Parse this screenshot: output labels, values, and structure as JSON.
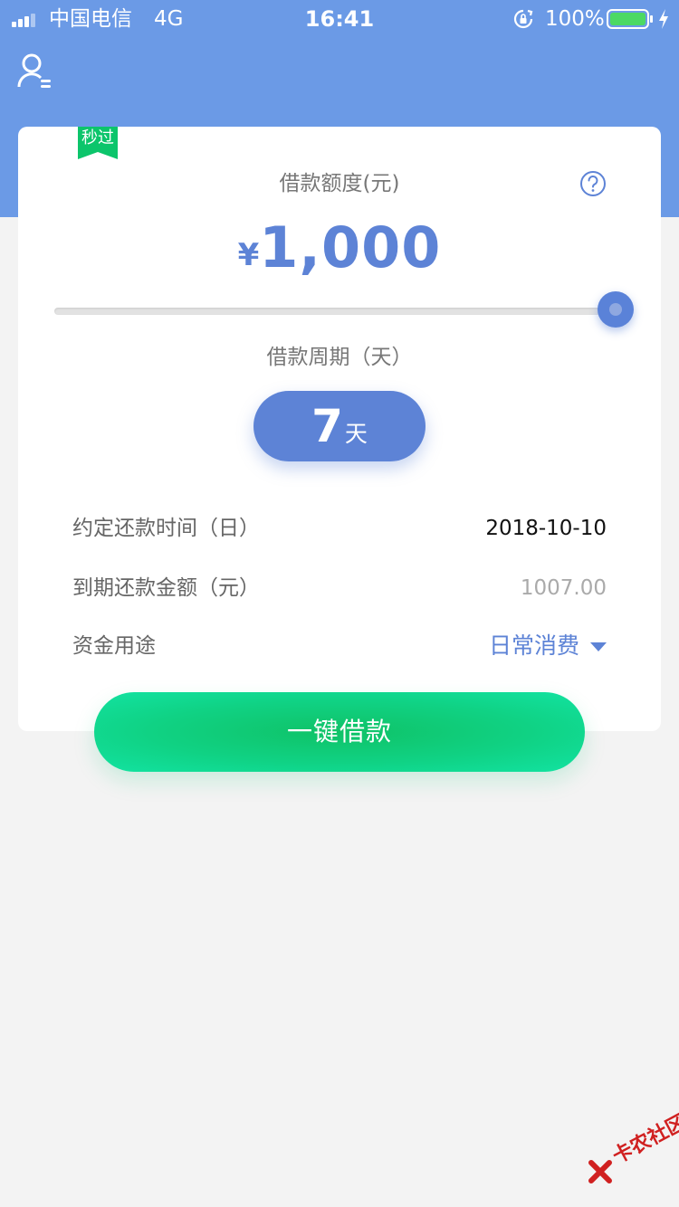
{
  "status_bar": {
    "carrier": "中国电信",
    "network": "4G",
    "time": "16:41",
    "battery_percent": "100%"
  },
  "header": {
    "profile_icon": "user-list-icon"
  },
  "card": {
    "badge": "秒过",
    "amount_label": "借款额度(元)",
    "currency_symbol": "¥",
    "amount_value": "1,000",
    "slider_level": 1.0,
    "period_label": "借款周期（天）",
    "period_value": "7",
    "period_unit": "天",
    "rows": [
      {
        "label": "约定还款时间（日）",
        "value": "2018-10-10"
      },
      {
        "label": "到期还款金额（元）",
        "value": "1007.00"
      },
      {
        "label": "资金用途",
        "value": "日常消费"
      }
    ]
  },
  "borrow_button": "一键借款",
  "watermark": "卡农社区",
  "colors": {
    "header_blue": "#6b9ae6",
    "accent_blue": "#5d83d6",
    "green": "#10d284",
    "badge_green": "#0cc56b"
  }
}
